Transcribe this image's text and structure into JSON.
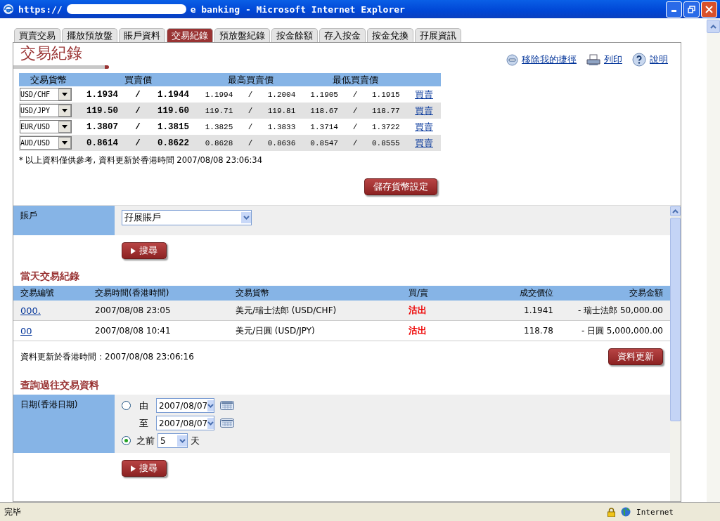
{
  "window": {
    "title_start": "https://",
    "title_end": "e banking - Microsoft Internet Explorer"
  },
  "tabs": [
    {
      "label": "買賣交易",
      "selected": false
    },
    {
      "label": "擺放預放盤",
      "selected": false
    },
    {
      "label": "賬戶資料",
      "selected": false
    },
    {
      "label": "交易紀錄",
      "selected": true
    },
    {
      "label": "預放盤紀錄",
      "selected": false
    },
    {
      "label": "按金餘額",
      "selected": false
    },
    {
      "label": "存入按金",
      "selected": false
    },
    {
      "label": "按金兌換",
      "selected": false
    },
    {
      "label": "孖展資訊",
      "selected": false
    }
  ],
  "page_title": "交易紀錄",
  "shortcuts": [
    {
      "kind": "remove",
      "label": "移除我的捷徑"
    },
    {
      "kind": "print",
      "label": "列印"
    },
    {
      "kind": "help",
      "label": "說明"
    }
  ],
  "rates": {
    "columns": [
      "交易貨幣",
      "買賣價",
      "最高買賣價",
      "最低買賣價"
    ],
    "separator": "/",
    "rows": [
      {
        "pair": "USD/CHF",
        "bid": "1.1934",
        "ask": "1.1944",
        "high_bid": "1.1994",
        "high_ask": "1.2004",
        "low_bid": "1.1905",
        "low_ask": "1.1915",
        "link": "買賣"
      },
      {
        "pair": "USD/JPY",
        "bid": "119.50",
        "ask": "119.60",
        "high_bid": "119.71",
        "high_ask": "119.81",
        "low_bid": "118.67",
        "low_ask": "118.77",
        "link": "買賣"
      },
      {
        "pair": "EUR/USD",
        "bid": "1.3807",
        "ask": "1.3815",
        "high_bid": "1.3825",
        "high_ask": "1.3833",
        "low_bid": "1.3714",
        "low_ask": "1.3722",
        "link": "買賣"
      },
      {
        "pair": "AUD/USD",
        "bid": "0.8614",
        "ask": "0.8622",
        "high_bid": "0.8628",
        "high_ask": "0.8636",
        "low_bid": "0.8547",
        "low_ask": "0.8555",
        "link": "買賣"
      }
    ],
    "note": "* 以上資料僅供參考, 資料更新於香港時間 2007/08/08 23:06:34",
    "save_button": "儲存貨幣設定"
  },
  "account": {
    "label": "賬戶",
    "value": "孖展賬戶",
    "search_button": "搜尋"
  },
  "today": {
    "heading": "當天交易紀錄",
    "columns": [
      "交易編號",
      "交易時間(香港時間)",
      "交易貨幣",
      "買/賣",
      "成交價位",
      "交易金額"
    ],
    "rows": [
      {
        "id": "000.",
        "time": "2007/08/08 23:05",
        "currency": "美元/瑞士法郎 (USD/CHF)",
        "side": "沽出",
        "price": "1.1941",
        "amount": "- 瑞士法郎 50,000.00"
      },
      {
        "id": "00",
        "time": "2007/08/08 10:41",
        "currency": "美元/日圓 (USD/JPY)",
        "side": "沽出",
        "price": "118.78",
        "amount": "- 日圓 5,000,000.00"
      }
    ],
    "update_note": "資料更新於香港時間：2007/08/08 23:06:16",
    "refresh_button": "資料更新"
  },
  "history": {
    "heading": "查詢過往交易資料",
    "date_label": "日期(香港日期)",
    "options": [
      {
        "kind": "range",
        "selected": false,
        "from_label": "由",
        "from": "2007/08/07",
        "to_label": "至",
        "to": "2007/08/07"
      },
      {
        "kind": "days",
        "selected": true,
        "label": "之前",
        "days": "5",
        "unit": "天"
      }
    ],
    "search_button": "搜尋"
  },
  "status_bar": {
    "text": "完毕",
    "zone": "Internet"
  }
}
